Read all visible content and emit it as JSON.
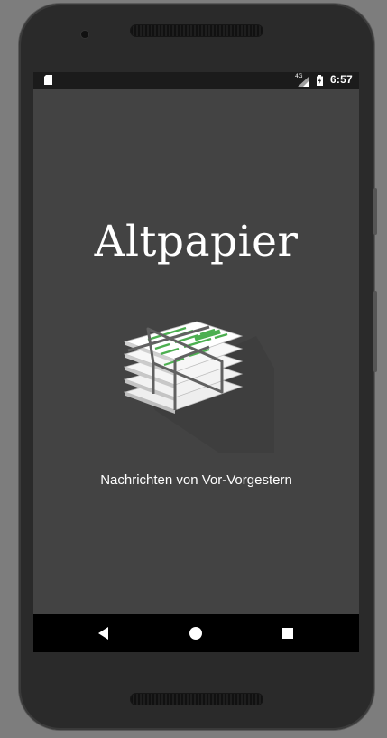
{
  "status_bar": {
    "network_label": "4G",
    "time": "6:57"
  },
  "app": {
    "title": "Altpapier",
    "tagline": "Nachrichten von Vor-Vorgestern",
    "logo_icon": "newspaper-bundle-icon",
    "accent_color": "#4caf50"
  },
  "nav_bar": {
    "back_icon": "back-icon",
    "home_icon": "home-icon",
    "recents_icon": "recents-icon"
  }
}
